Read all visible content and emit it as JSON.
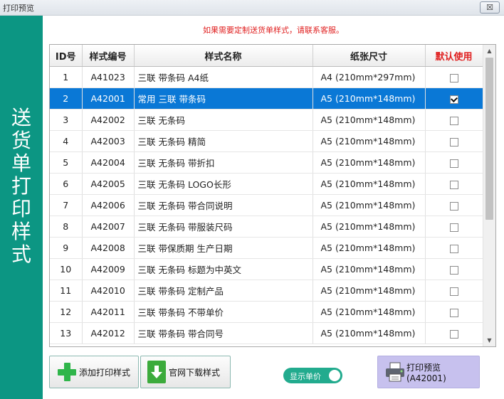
{
  "window": {
    "title": "打印预览",
    "close_label": "☒"
  },
  "sidebar": {
    "title_chars": [
      "送",
      "货",
      "单",
      "打",
      "印",
      "样",
      "式"
    ]
  },
  "notice": "如果需要定制送货单样式，请联系客服。",
  "table": {
    "columns": [
      "ID号",
      "样式编号",
      "样式名称",
      "纸张尺寸",
      "默认使用"
    ],
    "rows": [
      {
        "id": "1",
        "code": "A41023",
        "name": "三联 带条码 A4纸",
        "size": "A4 (210mm*297mm)",
        "default": false
      },
      {
        "id": "2",
        "code": "A42001",
        "name": "常用 三联 带条码",
        "size": "A5 (210mm*148mm)",
        "default": true
      },
      {
        "id": "3",
        "code": "A42002",
        "name": "三联 无条码",
        "size": "A5 (210mm*148mm)",
        "default": false
      },
      {
        "id": "4",
        "code": "A42003",
        "name": "三联 无条码 精简",
        "size": "A5 (210mm*148mm)",
        "default": false
      },
      {
        "id": "5",
        "code": "A42004",
        "name": "三联 无条码 带折扣",
        "size": "A5 (210mm*148mm)",
        "default": false
      },
      {
        "id": "6",
        "code": "A42005",
        "name": "三联 无条码 LOGO长形",
        "size": "A5 (210mm*148mm)",
        "default": false
      },
      {
        "id": "7",
        "code": "A42006",
        "name": "三联 无条码 带合同说明",
        "size": "A5 (210mm*148mm)",
        "default": false
      },
      {
        "id": "8",
        "code": "A42007",
        "name": "三联 无条码 带服装尺码",
        "size": "A5 (210mm*148mm)",
        "default": false
      },
      {
        "id": "9",
        "code": "A42008",
        "name": "三联 带保质期 生产日期",
        "size": "A5 (210mm*148mm)",
        "default": false
      },
      {
        "id": "10",
        "code": "A42009",
        "name": "三联 无条码 标题为中英文",
        "size": "A5 (210mm*148mm)",
        "default": false
      },
      {
        "id": "11",
        "code": "A42010",
        "name": "三联 带条码 定制产品",
        "size": "A5 (210mm*148mm)",
        "default": false
      },
      {
        "id": "12",
        "code": "A42011",
        "name": "三联 带条码 不带单价",
        "size": "A5 (210mm*148mm)",
        "default": false
      },
      {
        "id": "13",
        "code": "A42012",
        "name": "三联 带条码 带合同号",
        "size": "A5 (210mm*148mm)",
        "default": false
      }
    ],
    "selected_row": 2
  },
  "buttons": {
    "add_style": "添加打印样式",
    "download_style": "官网下载样式",
    "print_preview": "打印预览 (A42001)"
  },
  "toggle": {
    "label": "显示单价",
    "on": true
  },
  "colors": {
    "sidebar": "#0c9683",
    "selected_row": "#0a78d6",
    "notice_text": "#e02020",
    "toggle": "#22ab8e",
    "print_button": "#c7c1ee"
  }
}
